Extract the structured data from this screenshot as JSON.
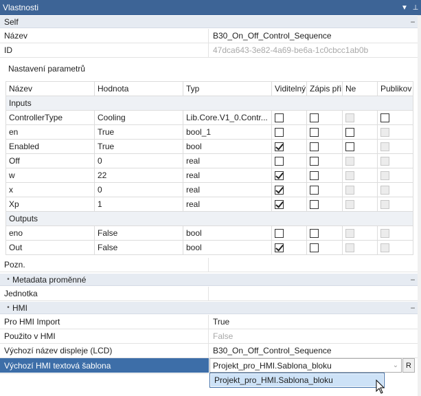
{
  "window": {
    "title": "Vlastnosti",
    "dropdown_glyph": "▼",
    "pin_glyph": "⊥"
  },
  "self_section": {
    "title": "Self"
  },
  "properties": {
    "nazev": {
      "name": "Název",
      "value": "B30_On_Off_Control_Sequence"
    },
    "id": {
      "name": "ID",
      "value": "47dca643-3e82-4a69-be6a-1c0cbcc1ab0b"
    }
  },
  "params": {
    "label": "Nastavení parametrů",
    "columns": [
      "Název",
      "Hodnota",
      "Typ",
      "Viditelný",
      "Zápis při",
      "Ne",
      "Publikov"
    ],
    "groups": [
      {
        "name": "Inputs",
        "rows": [
          {
            "name": "ControllerType",
            "value": "Cooling",
            "type": "Lib.Core.V1_0.Contr...",
            "visible": false,
            "write": false,
            "ne": false,
            "ne_disabled": true,
            "pub": false,
            "pub_disabled": false
          },
          {
            "name": "en",
            "value": "True",
            "type": "bool_1",
            "visible": false,
            "write": false,
            "ne": false,
            "ne_disabled": false,
            "pub": false,
            "pub_disabled": true
          },
          {
            "name": "Enabled",
            "value": "True",
            "type": "bool",
            "visible": true,
            "write": false,
            "ne": false,
            "ne_disabled": false,
            "pub": false,
            "pub_disabled": true
          },
          {
            "name": "Off",
            "value": "0",
            "type": "real",
            "visible": false,
            "write": false,
            "ne": false,
            "ne_disabled": true,
            "pub": false,
            "pub_disabled": true
          },
          {
            "name": "w",
            "value": "22",
            "type": "real",
            "visible": true,
            "write": false,
            "ne": false,
            "ne_disabled": true,
            "pub": false,
            "pub_disabled": true
          },
          {
            "name": "x",
            "value": "0",
            "type": "real",
            "visible": true,
            "write": false,
            "ne": false,
            "ne_disabled": true,
            "pub": false,
            "pub_disabled": true
          },
          {
            "name": "Xp",
            "value": "1",
            "type": "real",
            "visible": true,
            "write": false,
            "ne": false,
            "ne_disabled": true,
            "pub": false,
            "pub_disabled": true
          }
        ]
      },
      {
        "name": "Outputs",
        "rows": [
          {
            "name": "eno",
            "value": "False",
            "type": "bool",
            "visible": false,
            "write": false,
            "ne": false,
            "ne_disabled": true,
            "pub": false,
            "pub_disabled": true
          },
          {
            "name": "Out",
            "value": "False",
            "type": "bool",
            "visible": true,
            "write": false,
            "ne": false,
            "ne_disabled": true,
            "pub": false,
            "pub_disabled": true
          }
        ]
      }
    ]
  },
  "pozn": {
    "name": "Pozn.",
    "value": ""
  },
  "metadata_section": {
    "title": "Metadata proměnné"
  },
  "jednotka": {
    "name": "Jednotka",
    "value": ""
  },
  "hmi_section": {
    "title": "HMI"
  },
  "hmi": {
    "import": {
      "name": "Pro HMI Import",
      "value": "True"
    },
    "used": {
      "name": "Použito v HMI",
      "value": "False"
    },
    "lcd": {
      "name": "Výchozí název displeje (LCD)",
      "value": "B30_On_Off_Control_Sequence"
    },
    "template": {
      "name": "Výchozí HMI textová šablona",
      "value": "Projekt_pro_HMI.Sablona_bloku",
      "button": "R",
      "option": "Projekt_pro_HMI.Sablona_bloku"
    }
  },
  "icons": {
    "dropdown_arrow": "chevron-down-icon",
    "cursor": "mouse-pointer-icon"
  },
  "colors": {
    "title_bar": "#3d6496",
    "selection": "#3d6ea8",
    "section_bg": "#e6ebf2"
  }
}
